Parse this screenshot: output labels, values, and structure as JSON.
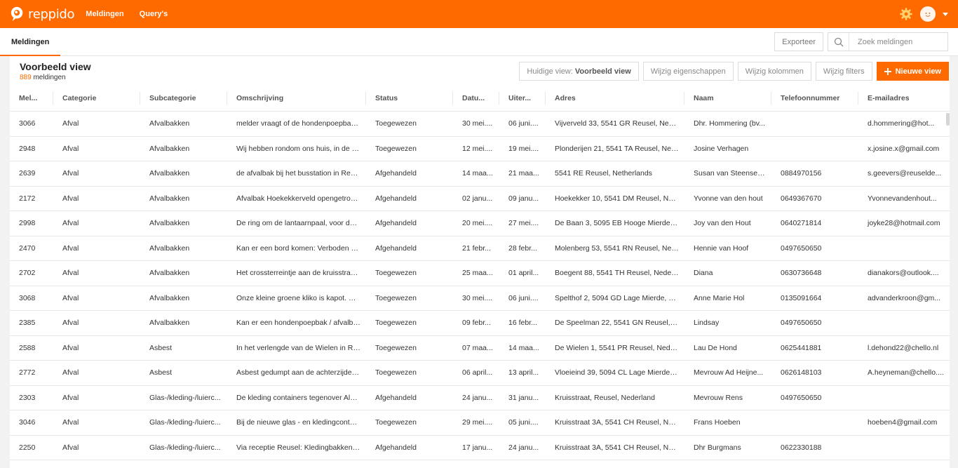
{
  "app": {
    "logo_text": "reppido",
    "nav": [
      "Meldingen",
      "Query's"
    ],
    "accent": "#ff6a00",
    "icons": {
      "settings": "gear-icon",
      "user": "avatar-icon",
      "search": "search-icon"
    }
  },
  "subbar": {
    "tab": "Meldingen",
    "export_label": "Exporteer",
    "search_placeholder": "Zoek meldingen"
  },
  "view": {
    "title": "Voorbeeld view",
    "count": "889",
    "count_suffix": " meldingen",
    "current_view_prefix": "Huidige view: ",
    "current_view_name": "Voorbeeld view",
    "edit_properties": "Wijzig eigenschappen",
    "edit_columns": "Wijzig kolommen",
    "edit_filters": "Wijzig filters",
    "new_view": "Nieuwe view"
  },
  "table": {
    "columns": [
      "Mel...",
      "Categorie",
      "Subcategorie",
      "Omschrijving",
      "Status",
      "Datu...",
      "Uiter...",
      "Adres",
      "Naam",
      "Telefoonnummer",
      "E-mailadres"
    ],
    "rows": [
      [
        "3066",
        "Afval",
        "Afvalbakken",
        "melder vraagt of de hondenpoepbak...",
        "Toegewezen",
        "30 mei....",
        "06 juni....",
        "Vijverveld 33, 5541 GR Reusel, Nederl...",
        "Dhr. Hommering (bv...",
        "",
        "d.hommering@hot..."
      ],
      [
        "2948",
        "Afval",
        "Afvalbakken",
        "Wij hebben rondom ons huis, in de st...",
        "Toegewezen",
        "12 mei....",
        "19 mei....",
        "Plonderijen 21, 5541 TA Reusel, Nede...",
        "Josine Verhagen",
        "",
        "x.josine.x@gmail.com"
      ],
      [
        "2639",
        "Afval",
        "Afvalbakken",
        "de afvalbak bij het busstation in Reus...",
        "Afgehandeld",
        "14 maa...",
        "21 maa...",
        "5541 RE Reusel, Netherlands",
        "Susan van Steensel-...",
        "0884970156",
        "s.geevers@reuselde..."
      ],
      [
        "2172",
        "Afval",
        "Afvalbakken",
        "Afvalbak Hoekekkerveld opengetrokk...",
        "Afgehandeld",
        "02 janu...",
        "09 janu...",
        "Hoekekker 10, 5541 DM Reusel, Ned...",
        "Yvonne van den hout",
        "0649367670",
        "Yvonnevandenhout..."
      ],
      [
        "2998",
        "Afval",
        "Afvalbakken",
        "De ring om de lantaarnpaal, voor de ...",
        "Afgehandeld",
        "20 mei....",
        "27 mei....",
        "De Baan 3, 5095 EB Hooge Mierde, N...",
        "Joy van den Hout",
        "0640271814",
        "joyke28@hotmail.com"
      ],
      [
        "2470",
        "Afval",
        "Afvalbakken",
        "Kan er een bord komen: Verboden h...",
        "Afgehandeld",
        "21 febr...",
        "28 febr...",
        "Molenberg 53, 5541 RN Reusel, Nede...",
        "Hennie van Hoof",
        "0497650650",
        ""
      ],
      [
        "2702",
        "Afval",
        "Afvalbakken",
        "Het crossterreintje aan de kruisstraat ...",
        "Toegewezen",
        "25 maa...",
        "01 april...",
        "Boegent 88, 5541 TH Reusel, Nederla...",
        "Diana",
        "0630736648",
        "dianakors@outlook...."
      ],
      [
        "3068",
        "Afval",
        "Afvalbakken",
        "Onze kleine groene kliko is kapot. Gr...",
        "Toegewezen",
        "30 mei....",
        "06 juni....",
        "Spelthof 2, 5094 GD Lage Mierde, Ne...",
        "Anne Marie Hol",
        "0135091664",
        "advanderkroon@gm..."
      ],
      [
        "2385",
        "Afval",
        "Afvalbakken",
        "Kan er een hondenpoepbak / afvalba...",
        "Toegewezen",
        "09 febr...",
        "16 febr...",
        "De Speelman 22, 5541 GN Reusel, Ne...",
        "Lindsay",
        "0497650650",
        ""
      ],
      [
        "2588",
        "Afval",
        "Asbest",
        "In het verlengde van de Wielen in Re...",
        "Toegewezen",
        "07 maa...",
        "14 maa...",
        "De Wielen 1, 5541 PR Reusel, Nederla...",
        "Lau De Hond",
        "0625441881",
        "l.dehond22@chello.nl"
      ],
      [
        "2772",
        "Afval",
        "Asbest",
        "Asbest gedumpt aan de achterzijde v...",
        "Toegewezen",
        "06 april...",
        "13 april...",
        "Vloeieind 39, 5094 CL Lage Mierde, N...",
        "Mevrouw Ad Heijne...",
        "0626148103",
        "A.heyneman@chello...."
      ],
      [
        "2303",
        "Afval",
        "Glas-/kleding-/luierc...",
        "De kleding containers tegenover Aldi...",
        "Afgehandeld",
        "24 janu...",
        "31 janu...",
        "Kruisstraat, Reusel, Nederland",
        "Mevrouw Rens",
        "0497650650",
        ""
      ],
      [
        "3046",
        "Afval",
        "Glas-/kleding-/luierc...",
        "Bij de nieuwe glas - en kledingcontai...",
        "Toegewezen",
        "29 mei....",
        "05 juni....",
        "Kruisstraat 3A, 5541 CH Reusel, Nede...",
        "Frans Hoeben",
        "",
        "hoeben4@gmail.com"
      ],
      [
        "2250",
        "Afval",
        "Glas-/kleding-/luierc...",
        "Via receptie Reusel: Kledingbakken gr...",
        "Afgehandeld",
        "17 janu...",
        "24 janu...",
        "Kruisstraat 3A, 5541 CH Reusel, Nede...",
        "Dhr Burgmans",
        "0622330188",
        ""
      ]
    ]
  }
}
